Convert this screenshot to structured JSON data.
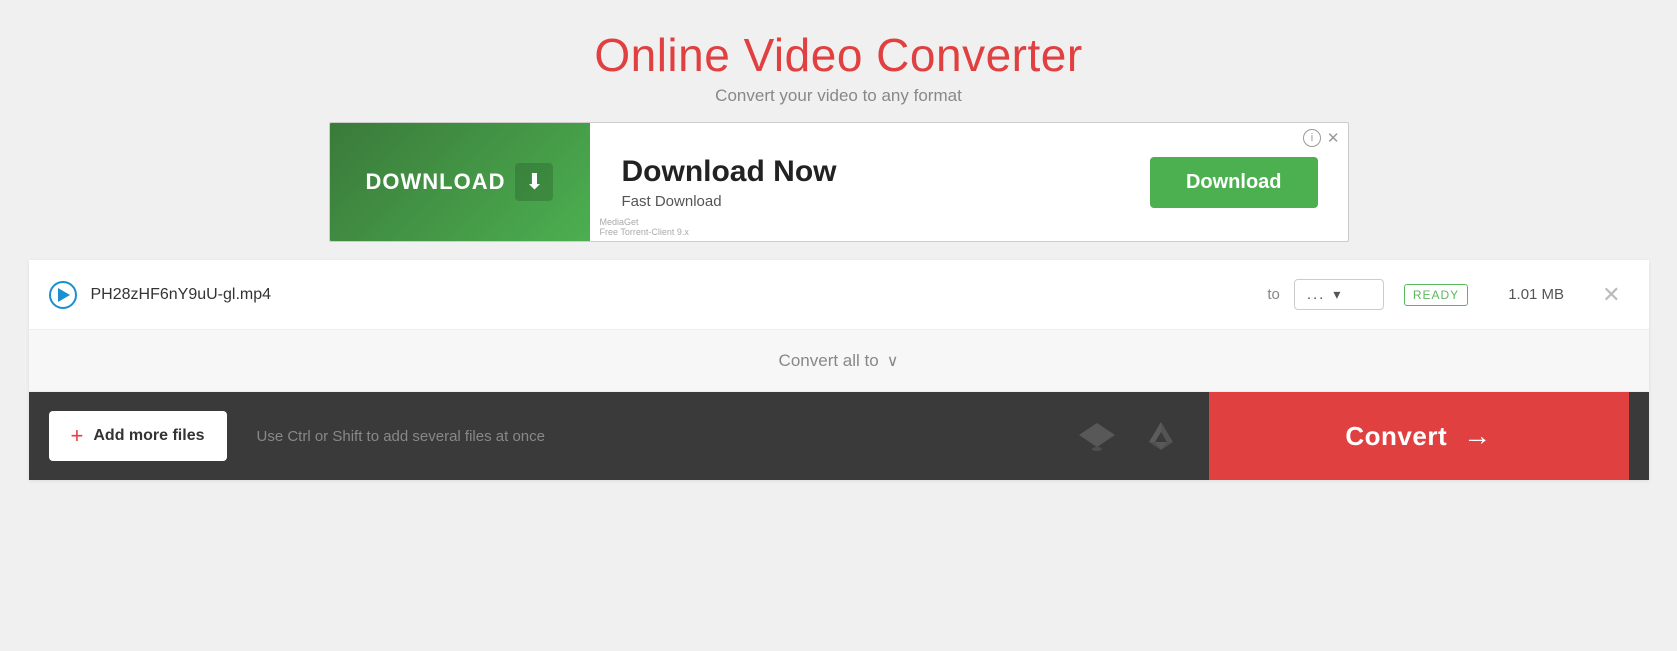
{
  "header": {
    "title": "Online Video Converter",
    "subtitle": "Convert your video to any format"
  },
  "ad": {
    "download_button_label": "DOWNLOAD",
    "main_text": "Download Now",
    "sub_text": "Fast Download",
    "action_button_label": "Download",
    "small_text": "MediaGet\nFree Torrent-Client 9.x",
    "info_icon": "ⓘ",
    "close_icon": "✕"
  },
  "file_row": {
    "file_name": "PH28zHF6nY9uU-gl.mp4",
    "to_label": "to",
    "format_placeholder": "...",
    "ready_badge": "READY",
    "file_size": "1.01 MB",
    "close_icon": "✕"
  },
  "convert_all_row": {
    "label": "Convert all to",
    "chevron": "∨"
  },
  "bottom_bar": {
    "add_more_label": "Add more files",
    "help_text": "Use Ctrl or Shift to add several files at once",
    "convert_label": "Convert"
  }
}
